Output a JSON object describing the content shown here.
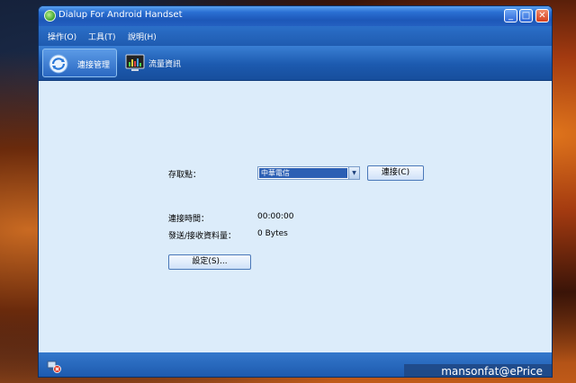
{
  "window": {
    "title": "Dialup For Android Handset"
  },
  "menubar": {
    "items": [
      {
        "label": "操作(O)"
      },
      {
        "label": "工具(T)"
      },
      {
        "label": "說明(H)"
      }
    ]
  },
  "toolbar": {
    "buttons": [
      {
        "label": "連接管理",
        "icon": "connection-manager-icon",
        "active": true
      },
      {
        "label": "流量資訊",
        "icon": "traffic-monitor-icon",
        "active": false
      }
    ]
  },
  "connection": {
    "apn_label": "存取點：",
    "apn_value": "中華電信",
    "connect_button": "連接(C)",
    "time_label": "連接時間：",
    "time_value": "00:00:00",
    "data_label": "發送/接收資料量：",
    "data_value": "0 Bytes",
    "settings_button": "設定(S)..."
  },
  "statusbar": {
    "icon": "disconnected-icon"
  },
  "watermark": "mansonfat@ePrice",
  "colors": {
    "title_bar": "#2a6fd3",
    "toolbar": "#1c5aaf",
    "content_bg": "#dcecfa",
    "selected": "#2b5fb4"
  }
}
